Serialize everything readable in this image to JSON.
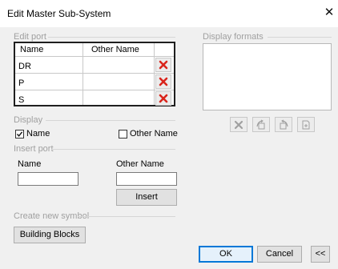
{
  "window": {
    "title": "Edit Master Sub-System",
    "close_glyph": "✕"
  },
  "edit_port": {
    "group_label": "Edit port",
    "columns": [
      "Name",
      "Other Name"
    ],
    "rows": [
      {
        "name": "DR",
        "other_name": ""
      },
      {
        "name": "P",
        "other_name": ""
      },
      {
        "name": "S",
        "other_name": ""
      }
    ],
    "delete_icon": "red-x-icon"
  },
  "display_formats": {
    "group_label": "Display formats",
    "toolbar_icons": [
      "delete-format-icon",
      "edit-format-icon",
      "copy-format-icon",
      "new-format-icon"
    ]
  },
  "display": {
    "group_label": "Display",
    "name_label": "Name",
    "name_checked": true,
    "other_name_label": "Other Name",
    "other_name_checked": false
  },
  "insert_port": {
    "group_label": "Insert port",
    "name_label": "Name",
    "name_value": "",
    "other_name_label": "Other Name",
    "other_name_value": "",
    "insert_button": "Insert"
  },
  "create_symbol": {
    "group_label": "Create new symbol",
    "building_blocks_button": "Building Blocks"
  },
  "footer": {
    "ok_button": "OK",
    "cancel_button": "Cancel",
    "collapse_button": "<<"
  },
  "colors": {
    "delete_icon_red": "#d9251c",
    "focus_blue": "#0078d7",
    "disabled_gray": "#a0a0a0"
  }
}
